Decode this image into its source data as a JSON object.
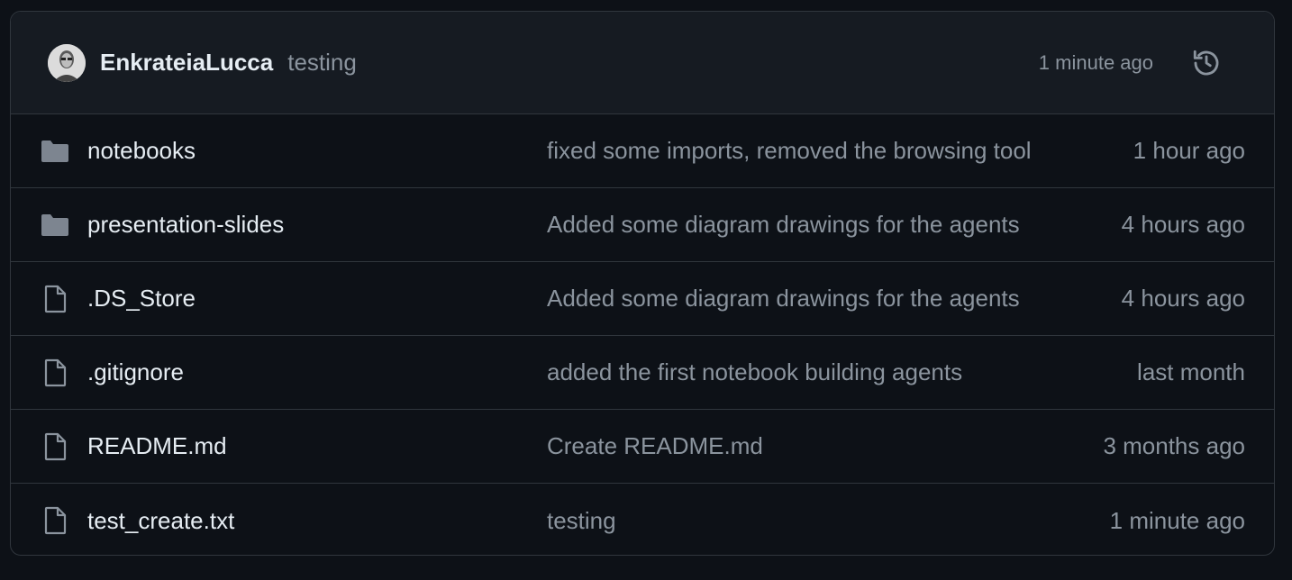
{
  "latest_commit": {
    "author": "EnkrateiaLucca",
    "message": "testing",
    "time": "1 minute ago",
    "avatar_icon": "user-avatar",
    "history_icon": "history-icon"
  },
  "files": [
    {
      "type": "folder",
      "name": "notebooks",
      "commit": "fixed some imports, removed the browsing tool",
      "time": "1 hour ago"
    },
    {
      "type": "folder",
      "name": "presentation-slides",
      "commit": "Added some diagram drawings for the agents",
      "time": "4 hours ago"
    },
    {
      "type": "file",
      "name": ".DS_Store",
      "commit": "Added some diagram drawings for the agents",
      "time": "4 hours ago"
    },
    {
      "type": "file",
      "name": ".gitignore",
      "commit": "added the first notebook building agents",
      "time": "last month"
    },
    {
      "type": "file",
      "name": "README.md",
      "commit": "Create README.md",
      "time": "3 months ago"
    },
    {
      "type": "file",
      "name": "test_create.txt",
      "commit": "testing",
      "time": "1 minute ago"
    }
  ],
  "colors": {
    "background": "#0d1117",
    "header_bg": "#161b22",
    "border": "#30363d",
    "text_primary": "#e6edf3",
    "text_muted": "#8b949e",
    "folder_icon": "#7d8590"
  }
}
